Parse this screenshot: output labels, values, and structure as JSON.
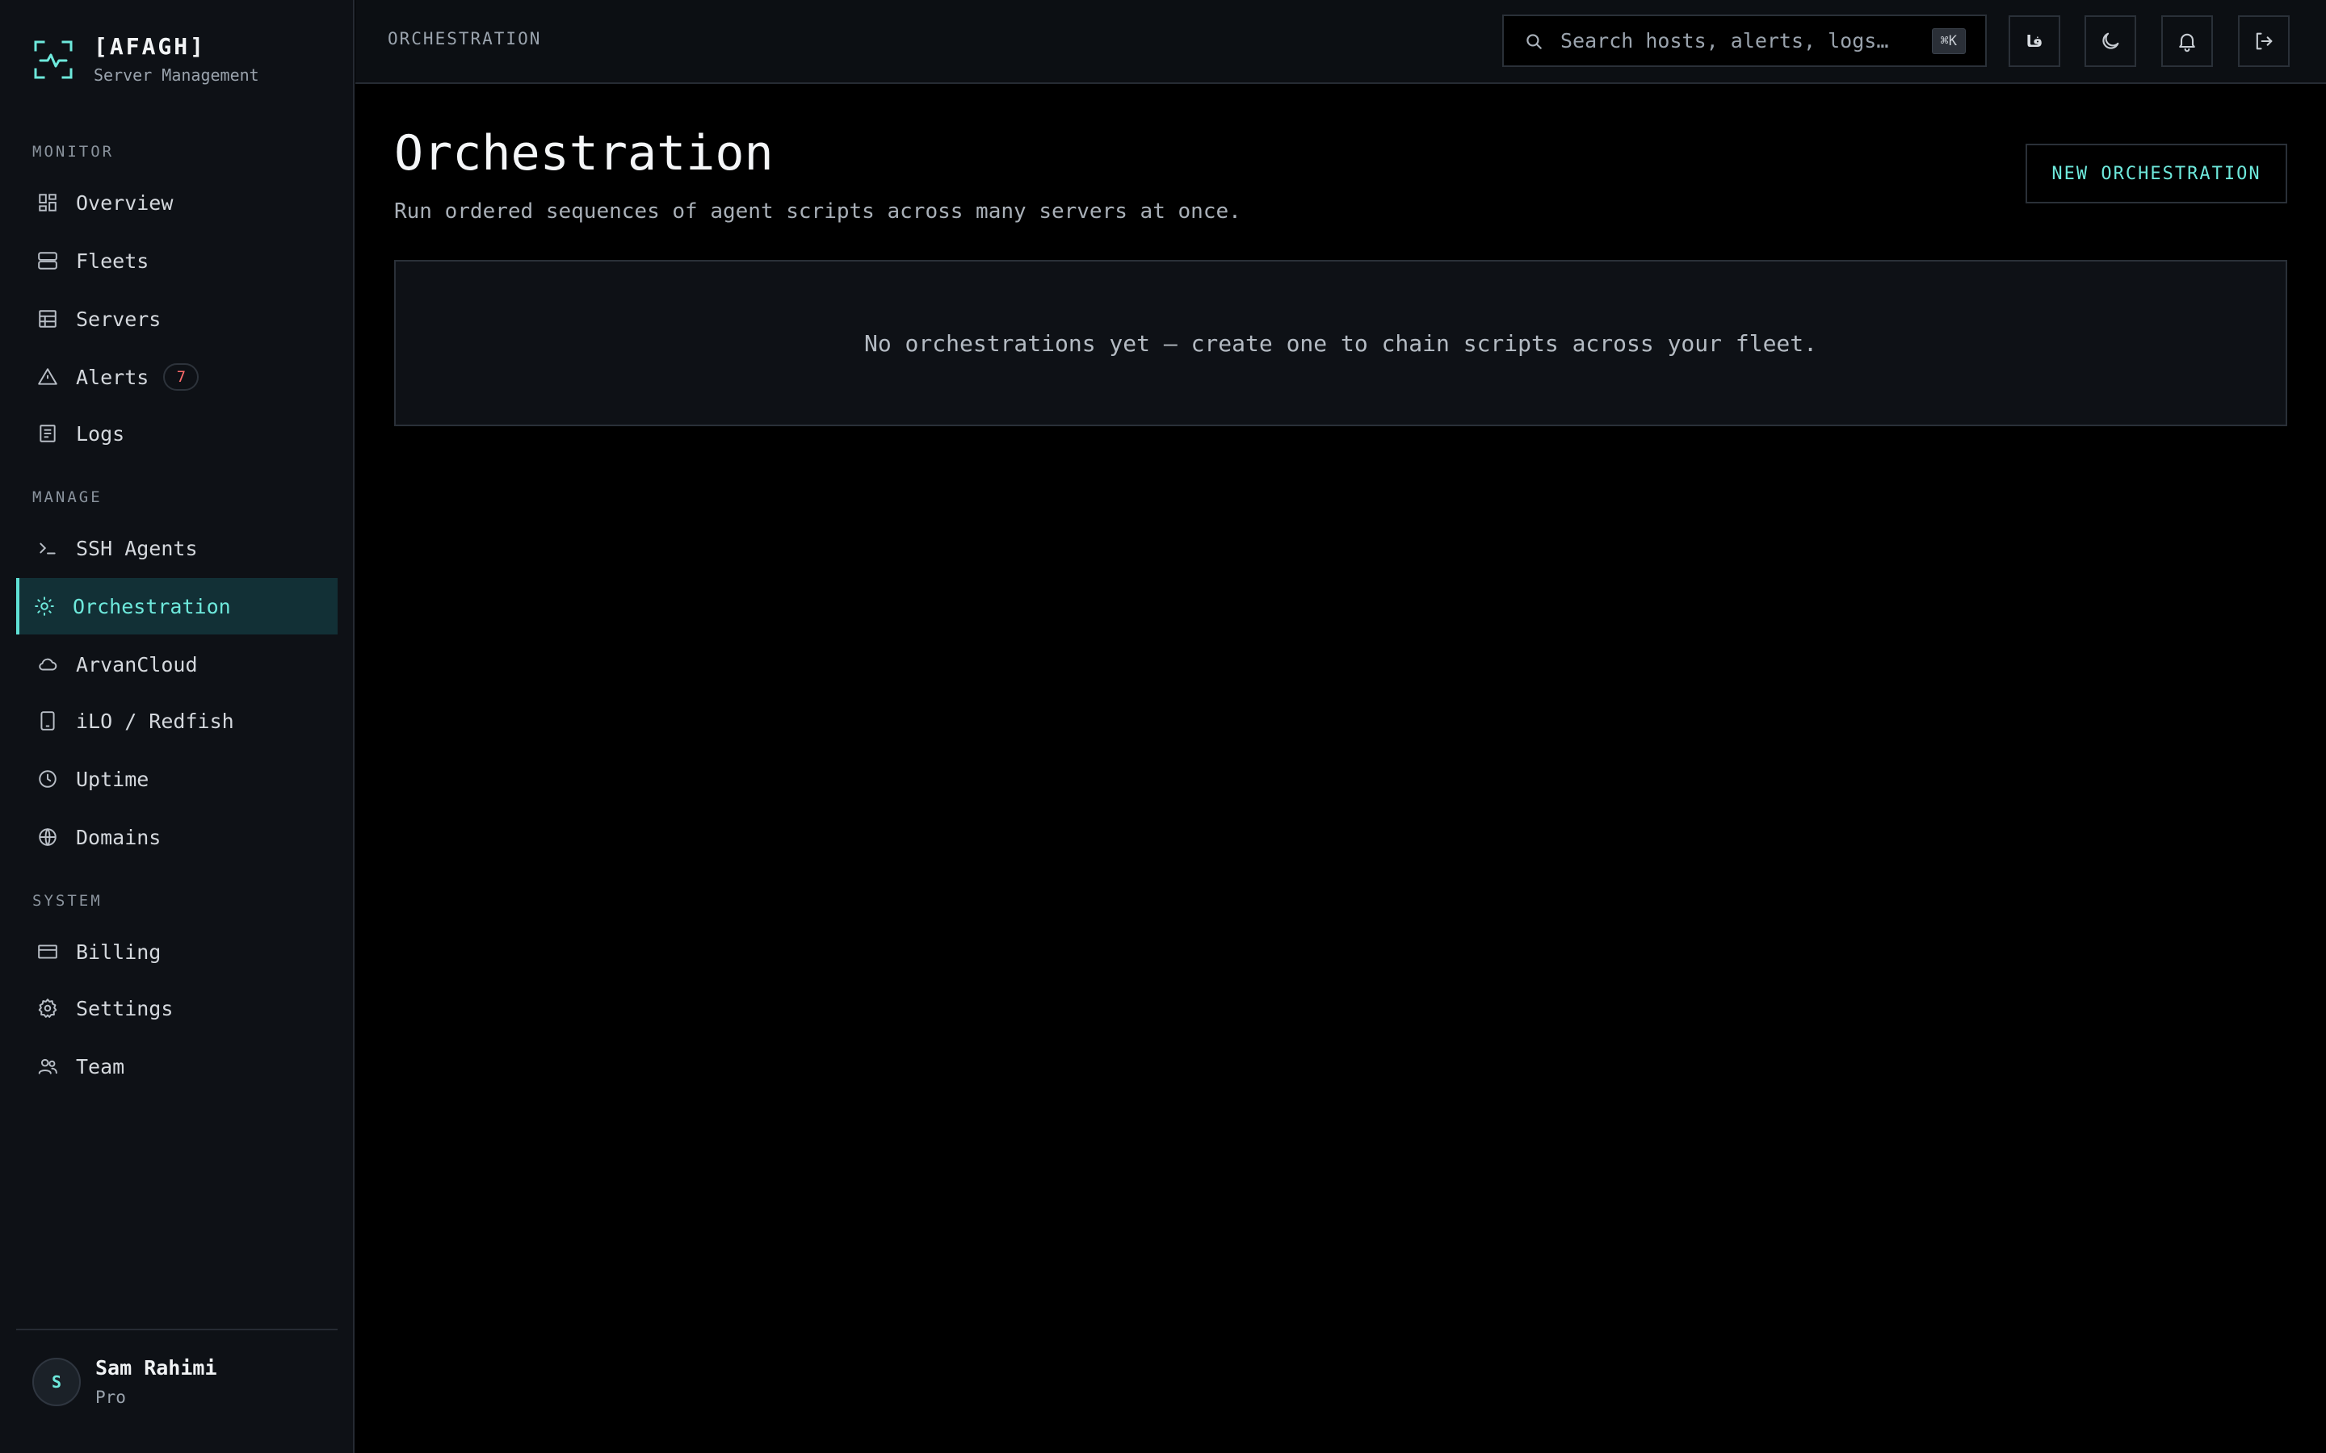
{
  "brand": {
    "title": "[AFAGH]",
    "subtitle": "Server Management"
  },
  "sidebar": {
    "sections": [
      {
        "label": "MONITOR"
      },
      {
        "label": "MANAGE"
      },
      {
        "label": "SYSTEM"
      }
    ],
    "items": [
      {
        "label": "Overview",
        "icon": "dashboard-icon"
      },
      {
        "label": "Fleets",
        "icon": "server-stack-icon"
      },
      {
        "label": "Servers",
        "icon": "server-table-icon"
      },
      {
        "label": "Alerts",
        "icon": "warning-triangle-icon",
        "badge": "7"
      },
      {
        "label": "Logs",
        "icon": "log-file-icon"
      },
      {
        "label": "SSH Agents",
        "icon": "terminal-prompt-icon"
      },
      {
        "label": "Orchestration",
        "icon": "sun-cog-icon",
        "active": true
      },
      {
        "label": "ArvanCloud",
        "icon": "cloud-icon"
      },
      {
        "label": "iLO / Redfish",
        "icon": "tablet-icon"
      },
      {
        "label": "Uptime",
        "icon": "clock-icon"
      },
      {
        "label": "Domains",
        "icon": "globe-icon"
      },
      {
        "label": "Billing",
        "icon": "credit-card-icon"
      },
      {
        "label": "Settings",
        "icon": "gear-icon"
      },
      {
        "label": "Team",
        "icon": "users-icon"
      }
    ]
  },
  "user": {
    "initial": "S",
    "name": "Sam Rahimi",
    "plan": "Pro"
  },
  "header": {
    "breadcrumb": "ORCHESTRATION",
    "search_placeholder": "Search hosts, alerts, logs…",
    "search_shortcut": "⌘K",
    "lang_label": "فا"
  },
  "main": {
    "title": "Orchestration",
    "subtitle": "Run ordered sequences of agent scripts across many servers at once.",
    "new_button": "NEW ORCHESTRATION",
    "empty_message": "No orchestrations yet — create one to chain scripts across your fleet."
  },
  "colors": {
    "accent": "#6ee9dc",
    "active_bg": "#123036",
    "alert": "#ff6b6b",
    "sidebar_bg": "#0e1116",
    "page_bg": "#000000"
  }
}
